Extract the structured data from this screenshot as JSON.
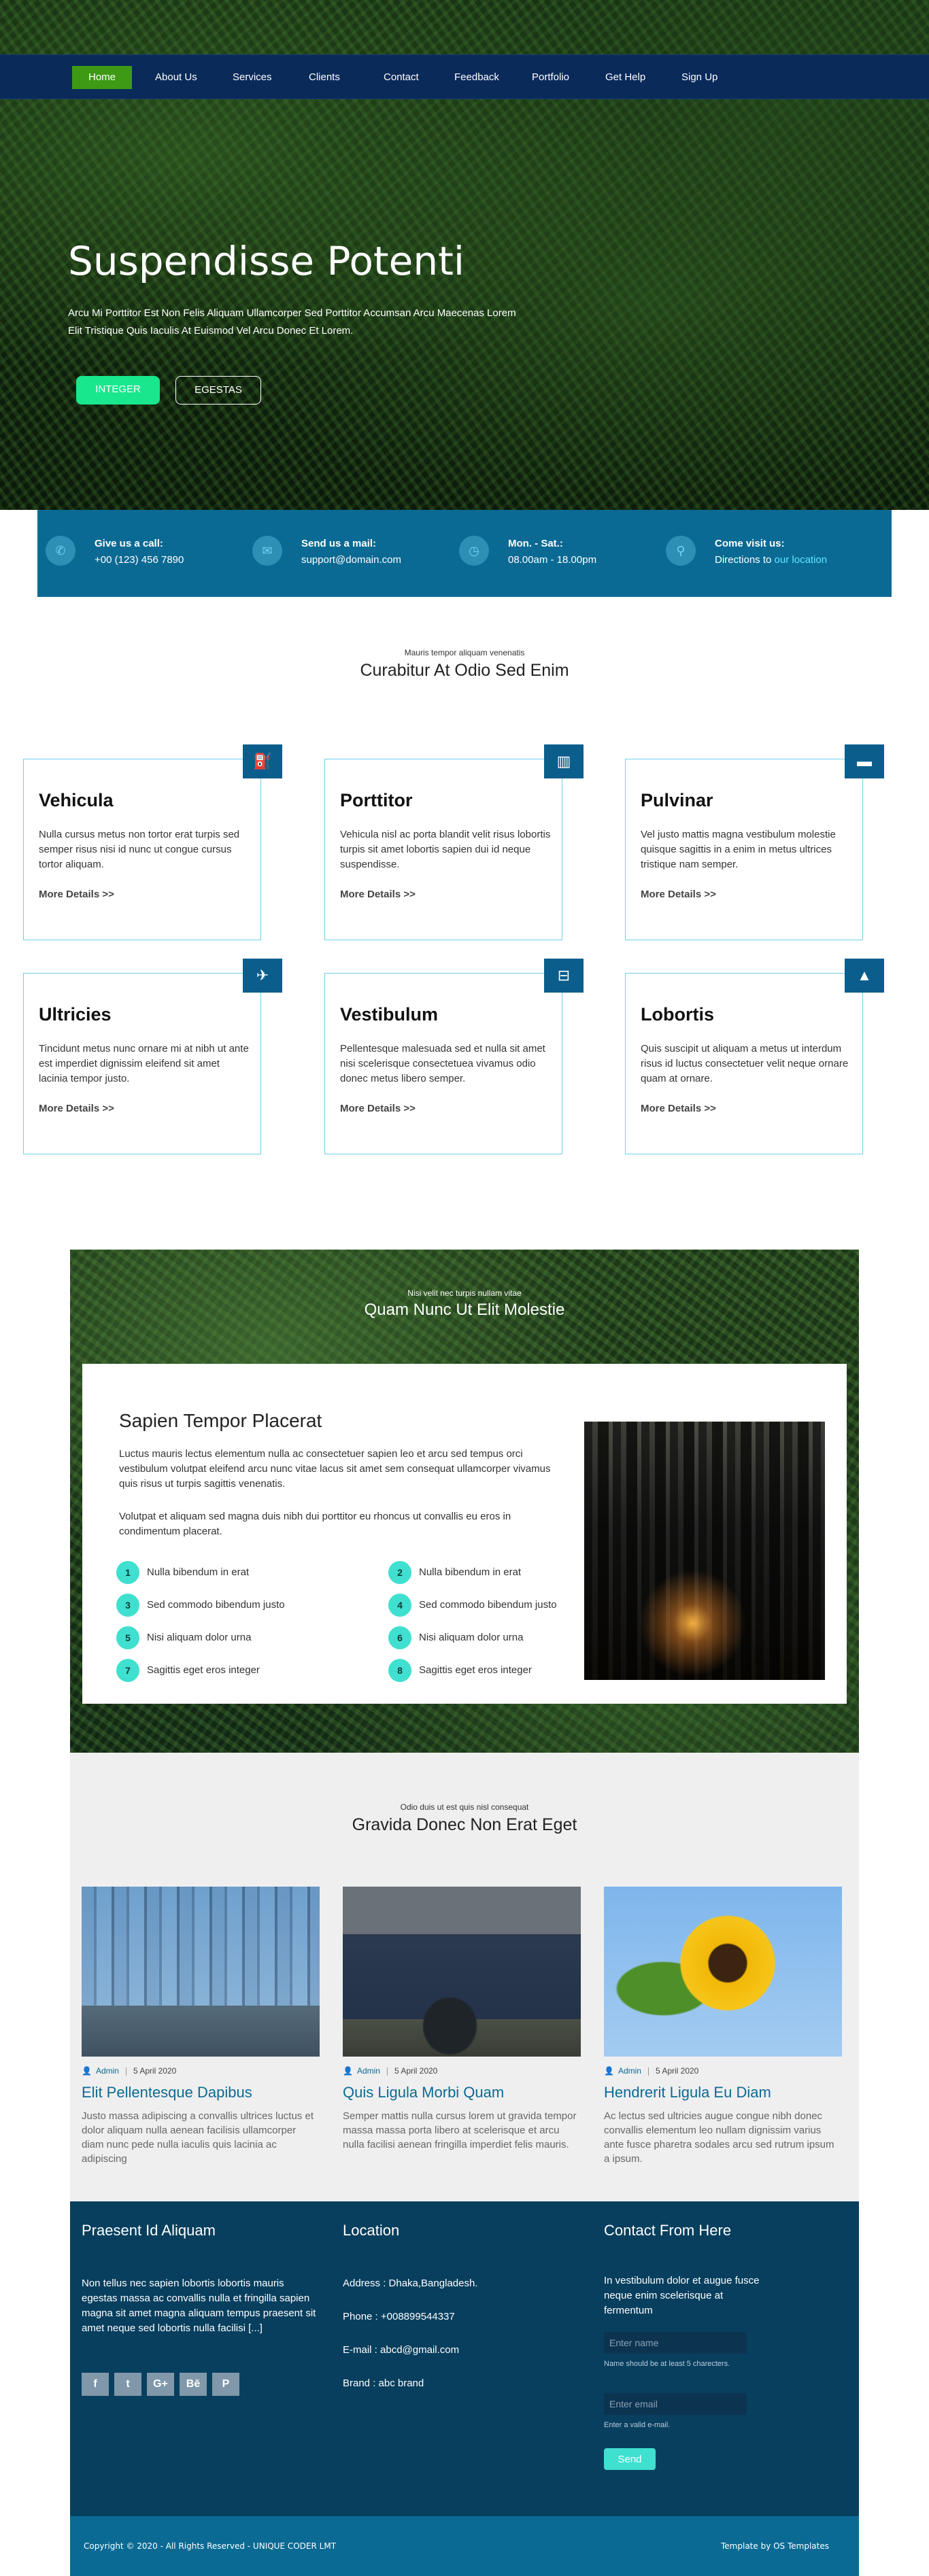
{
  "nav": [
    "Home",
    "About Us",
    "Services",
    "Clients",
    "Contact",
    "Feedback",
    "Portfolio",
    "Get Help",
    "Sign Up"
  ],
  "hero": {
    "title": "Suspendisse Potenti",
    "subtitle": "Arcu Mi Porttitor Est Non Felis Aliquam Ullamcorper Sed Porttitor Accumsan Arcu Maecenas Lorem Elit Tristique Quis Iaculis At Euismod Vel Arcu Donec Et Lorem.",
    "btn_primary": "INTEGER",
    "btn_secondary": "EGESTAS"
  },
  "info": [
    {
      "icon": "phone-icon",
      "title": "Give us a call:",
      "text": "+00 (123) 456 7890"
    },
    {
      "icon": "mail-icon",
      "title": "Send us a mail:",
      "text": "support@domain.com"
    },
    {
      "icon": "clock-icon",
      "title": "Mon. - Sat.:",
      "text": "08.00am - 18.00pm"
    },
    {
      "icon": "location-icon",
      "title": "Come visit us:",
      "text": "Directions to",
      "link": "our location"
    }
  ],
  "services": {
    "kicker": "Mauris tempor aliquam venenatis",
    "title": "Curabitur At Odio Sed Enim",
    "more_label": "More Details >>",
    "cards": [
      {
        "icon": "gas-station-icon",
        "title": "Vehicula",
        "text": "Nulla cursus metus non tortor erat turpis sed semper risus nisi id nunc ut congue cursus tortor aliquam."
      },
      {
        "icon": "building-icon",
        "title": "Porttitor",
        "text": "Vehicula nisl ac porta blandit velit risus lobortis turpis sit amet lobortis sapien dui id neque suspendisse."
      },
      {
        "icon": "sofa-icon",
        "title": "Pulvinar",
        "text": "Vel justo mattis magna vestibulum molestie quisque sagittis in a enim in metus ultrices tristique nam semper."
      },
      {
        "icon": "crow-icon",
        "title": "Ultricies",
        "text": "Tincidunt metus nunc ornare mi at nibh ut ante est imperdiet dignissim eleifend sit amet lacinia tempor justo."
      },
      {
        "icon": "dolly-icon",
        "title": "Vestibulum",
        "text": "Pellentesque malesuada sed et nulla sit amet nisi scelerisque consectetuea vivamus odio donec metus libero semper."
      },
      {
        "icon": "road-icon",
        "title": "Lobortis",
        "text": "Quis suscipit ut aliquam a metus ut interdum risus id luctus consectetuer velit neque ornare quam at ornare."
      }
    ]
  },
  "feature": {
    "kicker": "Nisi velit nec turpis nullam vitae",
    "title": "Quam Nunc Ut Elit Molestie",
    "box_title": "Sapien Tempor Placerat",
    "para1": "Luctus mauris lectus elementum nulla ac consectetuer sapien leo et arcu sed tempus orci vestibulum volutpat eleifend arcu nunc vitae lacus sit amet sem consequat ullamcorper vivamus quis risus ut turpis sagittis venenatis.",
    "para2": "Volutpat et aliquam sed magna duis nibh dui porttitor eu rhoncus ut convallis eu eros in condimentum placerat.",
    "list": [
      {
        "num": "1",
        "text": "Nulla bibendum in erat"
      },
      {
        "num": "2",
        "text": "Nulla bibendum in erat"
      },
      {
        "num": "3",
        "text": "Sed commodo bibendum justo"
      },
      {
        "num": "4",
        "text": "Sed commodo bibendum justo"
      },
      {
        "num": "5",
        "text": "Nisi aliquam dolor urna"
      },
      {
        "num": "6",
        "text": "Nisi aliquam dolor urna"
      },
      {
        "num": "7",
        "text": "Sagittis eget eros integer"
      },
      {
        "num": "8",
        "text": "Sagittis eget eros integer"
      }
    ]
  },
  "blog": {
    "kicker": "Odio duis ut est quis nisl consequat",
    "title": "Gravida Donec Non Erat Eget",
    "posts": [
      {
        "author": "Admin",
        "date": "5 April 2020",
        "title": "Elit Pellentesque Dapibus",
        "text": "Justo massa adipiscing a convallis ultrices luctus et dolor aliquam nulla aenean facilisis ullamcorper diam nunc pede nulla iaculis quis lacinia ac adipiscing"
      },
      {
        "author": "Admin",
        "date": "5 April 2020",
        "title": "Quis Ligula Morbi Quam",
        "text": "Semper mattis nulla cursus lorem ut gravida tempor massa massa porta libero at scelerisque et arcu nulla facilisi aenean fringilla imperdiet felis mauris."
      },
      {
        "author": "Admin",
        "date": "5 April 2020",
        "title": "Hendrerit Ligula Eu Diam",
        "text": "Ac lectus sed ultricies augue congue nibh donec convallis elementum leo nullam dignissim varius ante fusce pharetra sodales arcu sed rutrum ipsum a ipsum."
      }
    ]
  },
  "footer": {
    "about_title": "Praesent Id Aliquam",
    "about_text": "Non tellus nec sapien lobortis lobortis mauris egestas massa ac convallis nulla et fringilla sapien magna sit amet magna aliquam tempus praesent sit amet neque sed lobortis nulla facilisi [...]",
    "social": [
      "f",
      "t",
      "G+",
      "Bē",
      "P"
    ],
    "location_title": "Location",
    "address": "Address : Dhaka,Bangladesh.",
    "phone": "Phone : +008899544337",
    "email": "E-mail : abcd@gmail.com",
    "brand": "Brand : abc brand",
    "contact_title": "Contact From Here",
    "contact_text": "In vestibulum dolor et augue fusce neque enim scelerisque at fermentum",
    "name_placeholder": "Enter name",
    "name_hint": "Name should be at least 5 charecters.",
    "email_placeholder": "Enter email",
    "email_hint": "Enter a valid e-mail.",
    "send_label": "Send"
  },
  "copyright": {
    "left": "Copyright © 2020 - All Rights Reserved - UNIQUE CODER LMT",
    "right": "Template by OS Templates"
  },
  "colors": {
    "nav_bg": "#0a2a5a",
    "nav_active": "#3e9a14",
    "accent_teal": "#3fe0cf",
    "info_bar": "#0b6a93",
    "footer": "#083f5e",
    "primary_btn": "#18e78d"
  }
}
